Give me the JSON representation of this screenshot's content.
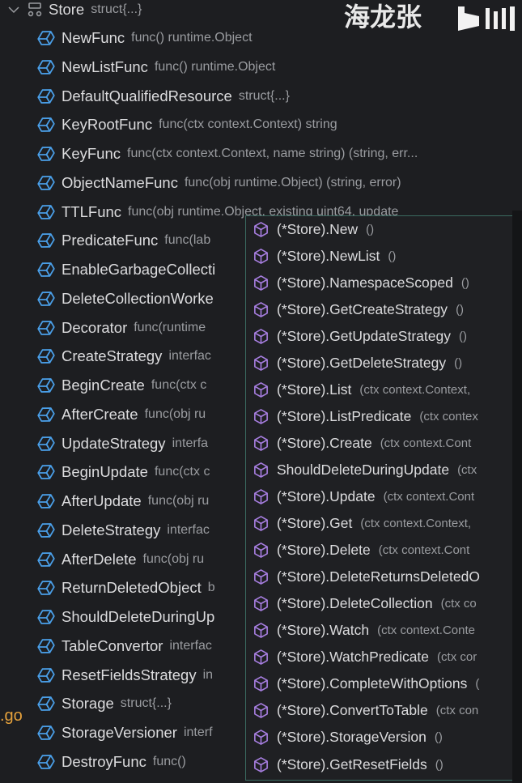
{
  "watermark": {
    "text": "海龙张",
    "logo": "bilibili"
  },
  "tree": {
    "root": {
      "name": "Store",
      "detail": "struct{...}",
      "icon": "struct-icon",
      "expanded": true
    },
    "fields": [
      {
        "name": "NewFunc",
        "detail": "func() runtime.Object"
      },
      {
        "name": "NewListFunc",
        "detail": "func() runtime.Object"
      },
      {
        "name": "DefaultQualifiedResource",
        "detail": "struct{...}"
      },
      {
        "name": "KeyRootFunc",
        "detail": "func(ctx context.Context) string"
      },
      {
        "name": "KeyFunc",
        "detail": "func(ctx context.Context, name string) (string, err..."
      },
      {
        "name": "ObjectNameFunc",
        "detail": "func(obj runtime.Object) (string, error)"
      },
      {
        "name": "TTLFunc",
        "detail": "func(obj runtime.Object, existing uint64, update"
      },
      {
        "name": "PredicateFunc",
        "detail": "func(lab"
      },
      {
        "name": "EnableGarbageCollecti",
        "detail": ""
      },
      {
        "name": "DeleteCollectionWorke",
        "detail": ""
      },
      {
        "name": "Decorator",
        "detail": "func(runtime"
      },
      {
        "name": "CreateStrategy",
        "detail": "interfac"
      },
      {
        "name": "BeginCreate",
        "detail": "func(ctx c"
      },
      {
        "name": "AfterCreate",
        "detail": "func(obj ru"
      },
      {
        "name": "UpdateStrategy",
        "detail": "interfa"
      },
      {
        "name": "BeginUpdate",
        "detail": "func(ctx c"
      },
      {
        "name": "AfterUpdate",
        "detail": "func(obj ru"
      },
      {
        "name": "DeleteStrategy",
        "detail": "interfac"
      },
      {
        "name": "AfterDelete",
        "detail": "func(obj ru"
      },
      {
        "name": "ReturnDeletedObject",
        "detail": "b"
      },
      {
        "name": "ShouldDeleteDuringUp",
        "detail": ""
      },
      {
        "name": "TableConvertor",
        "detail": "interfac"
      },
      {
        "name": "ResetFieldsStrategy",
        "detail": "in"
      },
      {
        "name": "Storage",
        "detail": "struct{...}"
      },
      {
        "name": "StorageVersioner",
        "detail": "interf"
      },
      {
        "name": "DestroyFunc",
        "detail": "func()"
      }
    ]
  },
  "side_text": ".go",
  "popup": {
    "items": [
      {
        "name": "(*Store).New",
        "detail": "()"
      },
      {
        "name": "(*Store).NewList",
        "detail": "()"
      },
      {
        "name": "(*Store).NamespaceScoped",
        "detail": "()"
      },
      {
        "name": "(*Store).GetCreateStrategy",
        "detail": "()"
      },
      {
        "name": "(*Store).GetUpdateStrategy",
        "detail": "()"
      },
      {
        "name": "(*Store).GetDeleteStrategy",
        "detail": "()"
      },
      {
        "name": "(*Store).List",
        "detail": "(ctx context.Context,"
      },
      {
        "name": "(*Store).ListPredicate",
        "detail": "(ctx contex"
      },
      {
        "name": "(*Store).Create",
        "detail": "(ctx context.Cont"
      },
      {
        "name": "ShouldDeleteDuringUpdate",
        "detail": "(ctx"
      },
      {
        "name": "(*Store).Update",
        "detail": "(ctx context.Cont"
      },
      {
        "name": "(*Store).Get",
        "detail": "(ctx context.Context,"
      },
      {
        "name": "(*Store).Delete",
        "detail": "(ctx context.Cont"
      },
      {
        "name": "(*Store).DeleteReturnsDeletedO",
        "detail": ""
      },
      {
        "name": "(*Store).DeleteCollection",
        "detail": "(ctx co"
      },
      {
        "name": "(*Store).Watch",
        "detail": "(ctx context.Conte"
      },
      {
        "name": "(*Store).WatchPredicate",
        "detail": "(ctx cor"
      },
      {
        "name": "(*Store).CompleteWithOptions",
        "detail": "("
      },
      {
        "name": "(*Store).ConvertToTable",
        "detail": "(ctx con"
      },
      {
        "name": "(*Store).StorageVersion",
        "detail": "()"
      },
      {
        "name": "(*Store).GetResetFields",
        "detail": "()"
      }
    ]
  },
  "colors": {
    "field_icon": "#4a9fe8",
    "method_icon": "#a77ee0",
    "background": "#1d1e21",
    "popup_border": "#3a6a60",
    "file_label": "#e6a23c"
  }
}
